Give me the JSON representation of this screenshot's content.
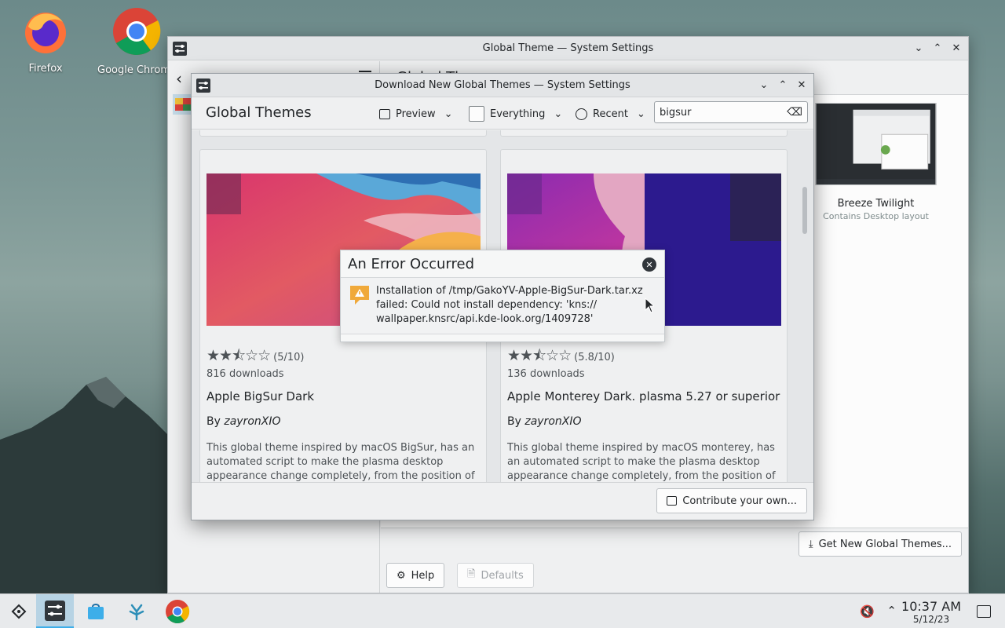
{
  "desktop": {
    "icons": [
      {
        "label": "Firefox",
        "icon": "firefox-icon"
      },
      {
        "label": "Google Chrome",
        "icon": "chrome-icon"
      }
    ]
  },
  "main_window": {
    "title": "Global Theme — System Settings",
    "page_heading": "Global Theme",
    "theme": {
      "name": "Breeze Twilight",
      "subtitle": "Contains Desktop layout"
    },
    "get_new_label": "Get New Global Themes...",
    "help_label": "Help",
    "defaults_label": "Defaults"
  },
  "dialog": {
    "title": "Download New Global Themes — System Settings",
    "heading": "Global Themes",
    "preview_label": "Preview",
    "filter_label": "Everything",
    "sort_label": "Recent",
    "search_value": "bigsur",
    "contribute_label": "Contribute your own...",
    "cards": [
      {
        "stars": "★★⯪☆☆",
        "rating": "(5/10)",
        "downloads": "816 downloads",
        "name": "Apple BigSur Dark",
        "author_prefix": "By",
        "author": "zayronXIO",
        "description": "This global theme inspired by macOS BigSur, has an automated script to make the plasma desktop appearance change completely, from the position of th..."
      },
      {
        "stars": "★★⯪☆☆",
        "rating": "(5.8/10)",
        "downloads": "136 downloads",
        "name": "Apple Monterey Dark. plasma 5.27 or superior",
        "author_prefix": "By",
        "author": "zayronXIO",
        "description": "This global theme inspired by macOS monterey, has an automated script to make the plasma desktop appearance change completely, from the position of th..."
      }
    ]
  },
  "error": {
    "title": "An Error Occurred",
    "message_line1": "Installation of /tmp/GakoYV-Apple-BigSur-Dark.tar.xz",
    "message_line2": "failed: Could not install dependency: 'kns://",
    "message_line3": "wallpaper.knsrc/api.kde-look.org/1409728'"
  },
  "taskbar": {
    "time": "10:37 AM",
    "date": "5/12/23"
  },
  "colors": {
    "accent": "#3daee9",
    "window_bg": "#eff0f1",
    "warning": "#f0a93a"
  }
}
